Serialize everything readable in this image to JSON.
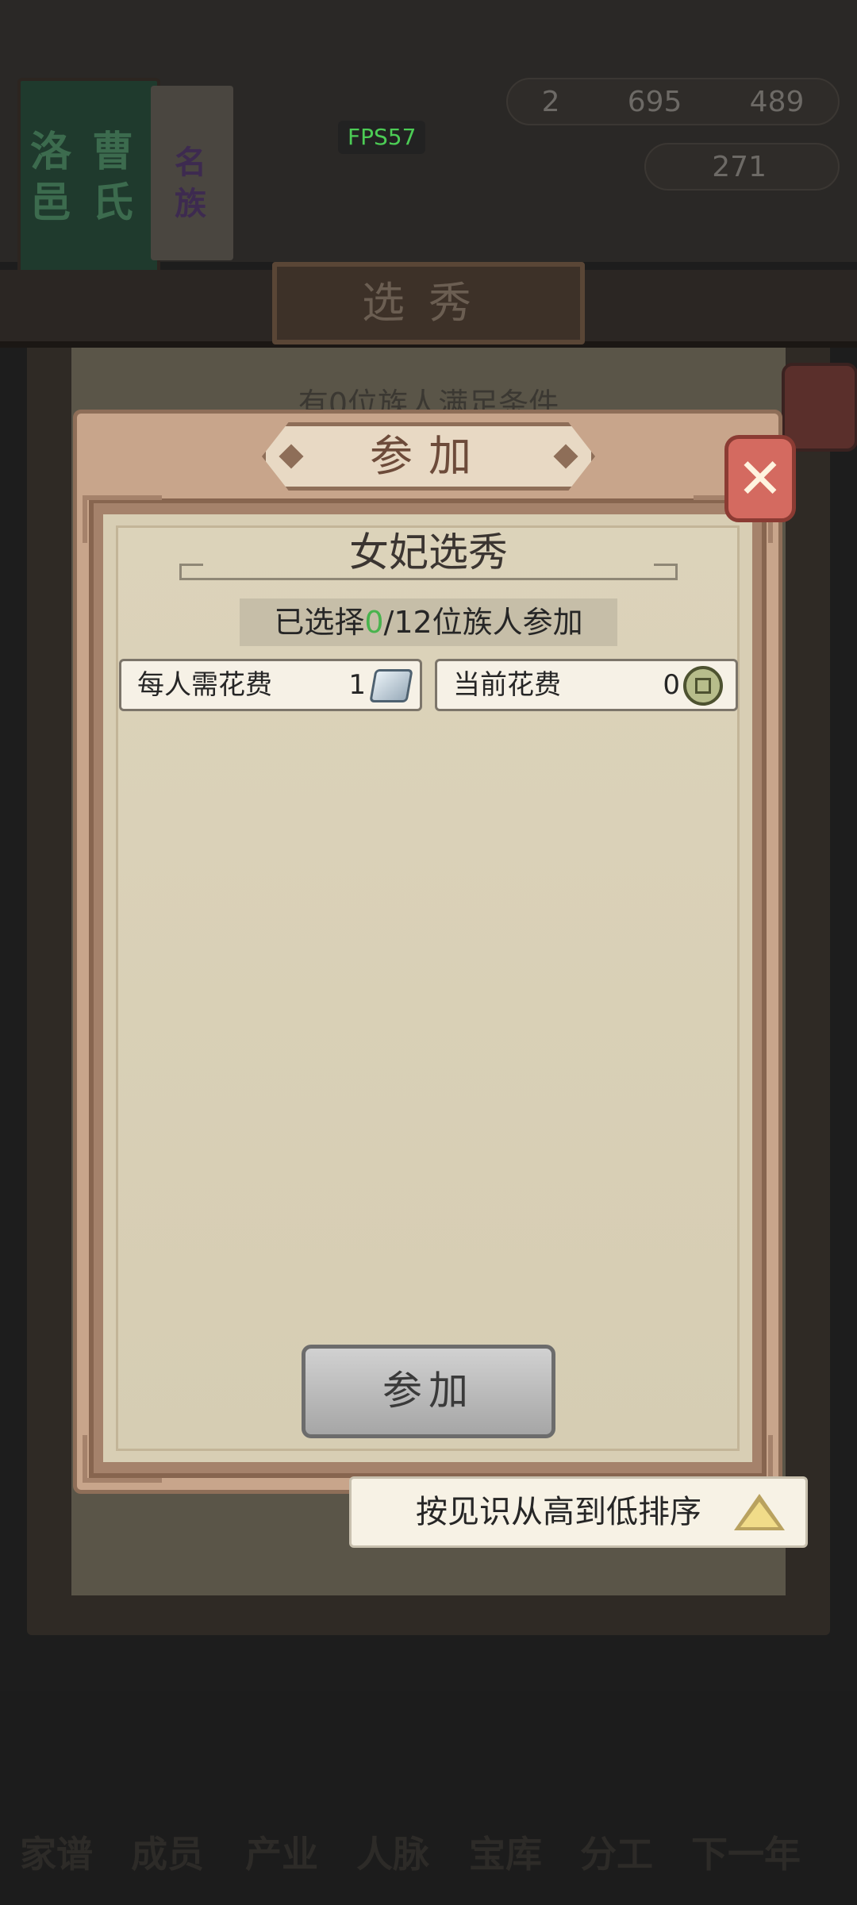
{
  "fps": "FPS57",
  "background": {
    "banner_lines": [
      "洛",
      "邑",
      "曹",
      "氏",
      "名",
      "族"
    ],
    "resources": {
      "gold_count": "2",
      "silver_count": "695",
      "coin_count": "489",
      "ingot_count": "271"
    },
    "page_title": "选秀",
    "condition_text": "有0位族人满足条件",
    "nav": [
      "家谱",
      "成员",
      "产业",
      "人脉",
      "宝库",
      "分工",
      "下一年"
    ]
  },
  "dialog": {
    "tag": "参加",
    "title": "女妃选秀",
    "selected_prefix": "已选择",
    "selected_count": "0",
    "selected_suffix": "/12位族人参加",
    "cost_per_person_label": "每人需花费",
    "cost_per_person_value": "1",
    "current_cost_label": "当前花费",
    "current_cost_value": "0",
    "join_button": "参加",
    "icons": {
      "cost_per_person": "silver-ingot-icon",
      "current_cost": "copper-coin-icon",
      "close": "close-icon",
      "sort": "triangle-up-icon"
    }
  },
  "sort_button": "按见识从高到低排序",
  "colors": {
    "accent_green": "#49b34e",
    "close_red": "#d46a60",
    "fps_green": "#4ccc55"
  }
}
